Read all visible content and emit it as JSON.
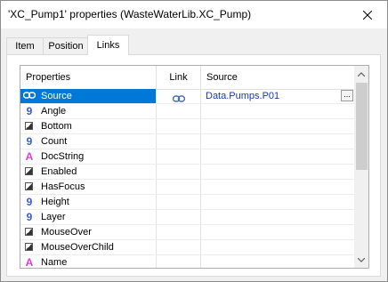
{
  "window": {
    "title": "'XC_Pump1' properties (WasteWaterLib.XC_Pump)",
    "close_glyph": "✕"
  },
  "tabs": [
    {
      "label": "Item"
    },
    {
      "label": "Position"
    },
    {
      "label": "Links"
    }
  ],
  "grid": {
    "headers": {
      "properties": "Properties",
      "link": "Link",
      "source": "Source"
    },
    "rows": [
      {
        "name": "Source",
        "icon": "link-icon",
        "linked": true,
        "source": "Data.Pumps.P01",
        "selected": true
      },
      {
        "name": "Angle",
        "icon": "number-icon"
      },
      {
        "name": "Bottom",
        "icon": "boolean-icon"
      },
      {
        "name": "Count",
        "icon": "number-icon"
      },
      {
        "name": "DocString",
        "icon": "string-icon"
      },
      {
        "name": "Enabled",
        "icon": "boolean-icon"
      },
      {
        "name": "HasFocus",
        "icon": "boolean-icon"
      },
      {
        "name": "Height",
        "icon": "number-icon"
      },
      {
        "name": "Layer",
        "icon": "number-icon"
      },
      {
        "name": "MouseOver",
        "icon": "boolean-icon"
      },
      {
        "name": "MouseOverChild",
        "icon": "boolean-icon"
      },
      {
        "name": "Name",
        "icon": "string-icon"
      }
    ],
    "browse_label": "..."
  },
  "icon_glyphs": {
    "number": "9",
    "string": "A"
  },
  "colors": {
    "selection": "#0078d7",
    "source_text": "#1a3aa8",
    "number_icon": "#3a5bd1",
    "string_icon": "#e03ad8"
  }
}
